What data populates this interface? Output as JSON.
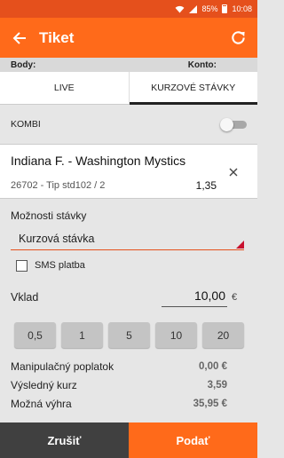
{
  "status_bar": {
    "battery": "85%",
    "time": "10:08",
    "icons": [
      "wifi-icon",
      "signal-icon",
      "battery-icon"
    ],
    "color": "#e5501c"
  },
  "app_bar": {
    "title": "Tiket",
    "icons": [
      "back-arrow-icon",
      "refresh-icon"
    ],
    "color": "#ff6a1a"
  },
  "account": {
    "body_label": "Body:",
    "konto_label": "Konto:"
  },
  "tabs": [
    {
      "label": "LIVE",
      "active": false
    },
    {
      "label": "KURZOVÉ STÁVKY",
      "active": true
    }
  ],
  "kombi": {
    "label": "KOMBI",
    "enabled": false
  },
  "bet": {
    "match": "Indiana F. - Washington Mystics",
    "tip": "26702 - Tip std102 / 2",
    "odd": "1,35"
  },
  "options": {
    "label": "Možnosti stávky",
    "selected": "Kurzová stávka",
    "sms_label": "SMS platba",
    "sms_checked": false
  },
  "stake": {
    "label": "Vklad",
    "value": "10,00",
    "currency": "€",
    "quick_amounts": [
      "0,5",
      "1",
      "5",
      "10",
      "20"
    ]
  },
  "summary": [
    {
      "label": "Manipulačný poplatok",
      "value": "0,00 €"
    },
    {
      "label": "Výsledný kurz",
      "value": "3,59"
    },
    {
      "label": "Možná výhra",
      "value": "35,95 €"
    }
  ],
  "actions": {
    "cancel": "Zrušiť",
    "submit": "Podať"
  }
}
